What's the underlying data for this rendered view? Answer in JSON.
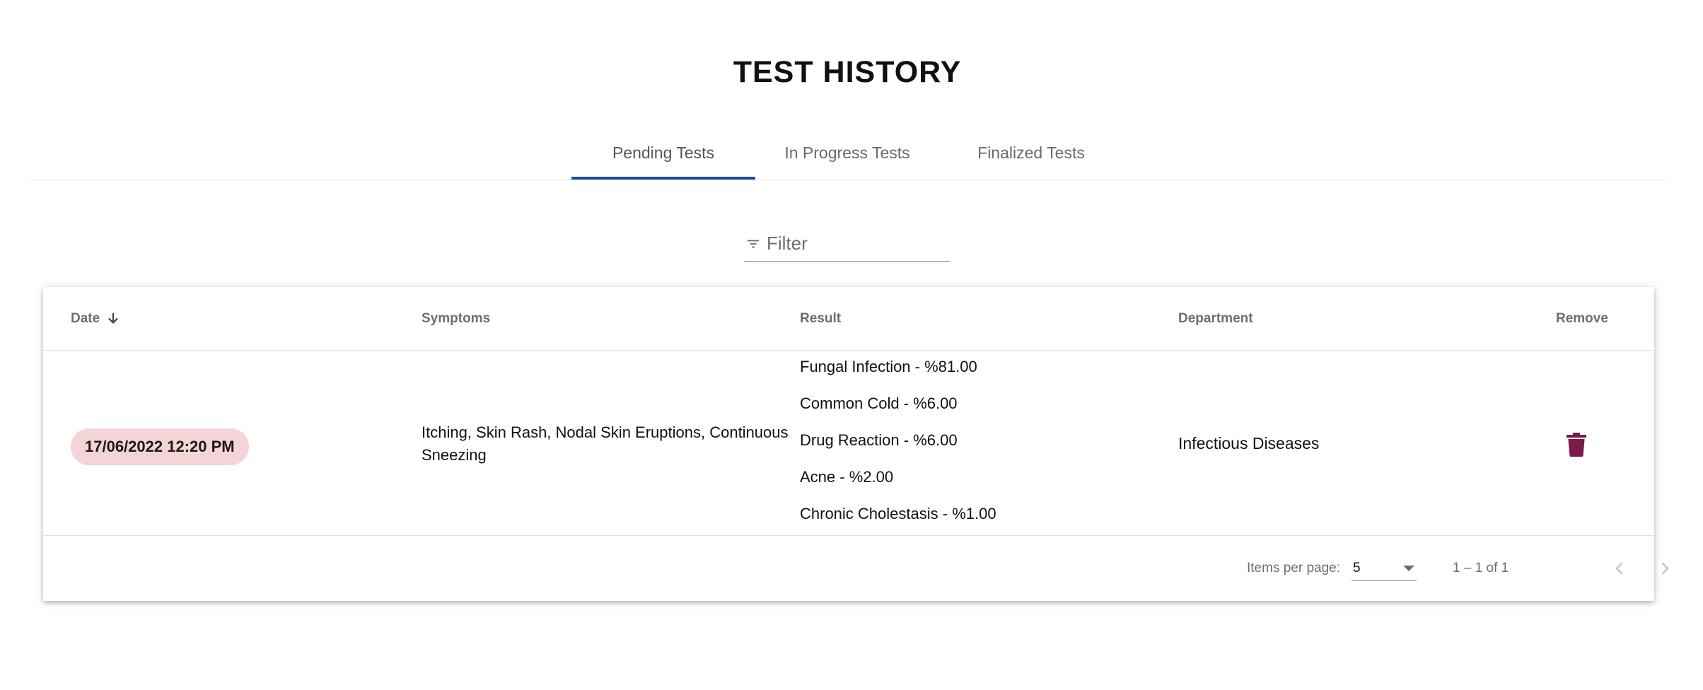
{
  "page": {
    "title": "TEST HISTORY"
  },
  "tabs": [
    {
      "label": "Pending Tests",
      "active": true
    },
    {
      "label": "In Progress Tests",
      "active": false
    },
    {
      "label": "Finalized Tests",
      "active": false
    }
  ],
  "filter": {
    "placeholder": "Filter",
    "value": "",
    "icon": "filter-list-icon"
  },
  "table": {
    "columns": [
      "Date",
      "Symptoms",
      "Result",
      "Department",
      "Remove"
    ],
    "sort": {
      "column": "Date",
      "direction": "descending",
      "icon": "arrow-downward-icon"
    },
    "rows": [
      {
        "date": "17/06/2022 12:20 PM",
        "symptoms": "Itching, Skin Rash, Nodal Skin Eruptions, Continuous Sneezing",
        "results": [
          "Fungal Infection - %81.00",
          "Common Cold - %6.00",
          "Drug Reaction - %6.00",
          "Acne - %2.00",
          "Chronic Cholestasis - %1.00"
        ],
        "department": "Infectious Diseases",
        "remove_icon": "trash-icon"
      }
    ]
  },
  "paginator": {
    "items_per_page_label": "Items per page:",
    "items_per_page_value": "5",
    "range_label": "1 – 1 of 1",
    "prev_icon": "chevron-left-icon",
    "next_icon": "chevron-right-icon"
  },
  "colors": {
    "tab_ink": "#1a4fa0",
    "date_chip_bg": "#f4d4d6",
    "remove_icon": "#7b1a4b"
  }
}
